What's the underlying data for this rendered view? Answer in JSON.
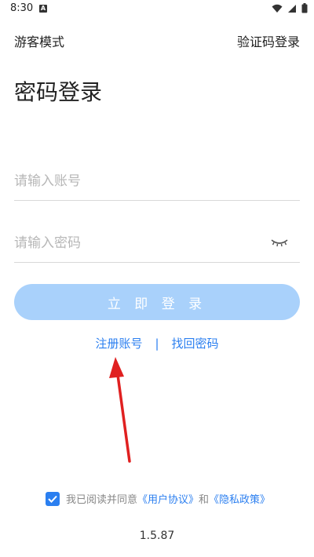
{
  "status_bar": {
    "time": "8:30",
    "notification_icon": "a-icon",
    "right_icons": [
      "wifi-icon",
      "cellular-icon",
      "battery-icon"
    ]
  },
  "nav": {
    "guest_mode": "游客模式",
    "verification_login": "验证码登录"
  },
  "title": "密码登录",
  "account_field": {
    "placeholder": "请输入账号"
  },
  "password_field": {
    "placeholder": "请输入密码",
    "toggle_icon": "eye-closed-icon"
  },
  "login_button": "立 即 登 录",
  "links": {
    "register": "注册账号",
    "separator": "|",
    "forgot_password": "找回密码"
  },
  "agreement": {
    "checked": true,
    "prefix": "我已阅读并同意",
    "user_agreement": "《用户协议》",
    "and": "和",
    "privacy_policy": "《隐私政策》"
  },
  "version": "1.5.87",
  "colors": {
    "accent": "#2b7ff0",
    "login_button_disabled": "#a9d1fb",
    "arrow": "#e02020"
  }
}
